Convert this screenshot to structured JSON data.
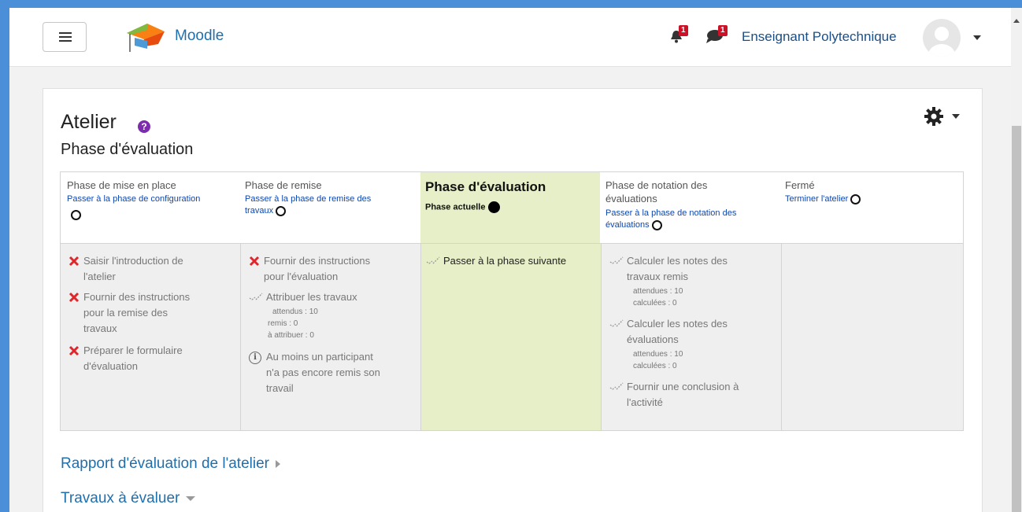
{
  "header": {
    "brand": "Moodle",
    "notification_count": "1",
    "message_count": "1",
    "user_name": "Enseignant Polytechnique"
  },
  "page": {
    "title": "Atelier",
    "subtitle": "Phase d'évaluation"
  },
  "phases": [
    {
      "title": "Phase de mise en place",
      "link": "Passer à la phase de configuration",
      "tasks": [
        {
          "status": "cross",
          "label": "Saisir l'introduction de",
          "label2": "l'atelier"
        },
        {
          "status": "cross",
          "label": "Fournir des instructions",
          "label2": "pour la remise des",
          "label3": "travaux"
        },
        {
          "status": "cross",
          "label": "Préparer le formulaire",
          "label2": "d'évaluation"
        }
      ]
    },
    {
      "title": "Phase de remise",
      "link": "Passer à la phase de remise des",
      "link2": "travaux",
      "tasks": [
        {
          "status": "cross",
          "label": "Fournir des instructions",
          "label2": "pour l'évaluation"
        },
        {
          "status": "check",
          "label": "Attribuer les travaux",
          "details": [
            "attendus : 10",
            "remis : 0",
            "à attribuer : 0"
          ]
        },
        {
          "status": "info",
          "label": "Au moins un participant",
          "label2": "n'a pas encore remis son",
          "label3": "travail"
        }
      ]
    },
    {
      "title": "Phase d'évaluation",
      "status": "Phase actuelle",
      "tasks": [
        {
          "status": "check",
          "label": "Passer à la phase suivante"
        }
      ]
    },
    {
      "title": "Phase de notation des",
      "title2": "évaluations",
      "link": "Passer à la phase de notation des",
      "link2": "évaluations",
      "tasks": [
        {
          "status": "check",
          "label": "Calculer les notes des",
          "label2": "travaux remis",
          "details": [
            "attendues : 10",
            "calculées : 0"
          ]
        },
        {
          "status": "check",
          "label": "Calculer les notes des",
          "label2": "évaluations",
          "details": [
            "attendues : 10",
            "calculées : 0"
          ]
        },
        {
          "status": "check",
          "label": "Fournir une conclusion à",
          "label2": "l'activité"
        }
      ]
    },
    {
      "title": "Fermé",
      "link": "Terminer l'atelier",
      "tasks": []
    }
  ],
  "sections": {
    "report": "Rapport d'évaluation de l'atelier",
    "to_evaluate": "Travaux à évaluer"
  },
  "colors": {
    "link": "#0f47ad",
    "brand": "#1f6fad",
    "current_phase": "#e6efc8",
    "cross": "#e0262a",
    "badge": "#ce1126"
  }
}
